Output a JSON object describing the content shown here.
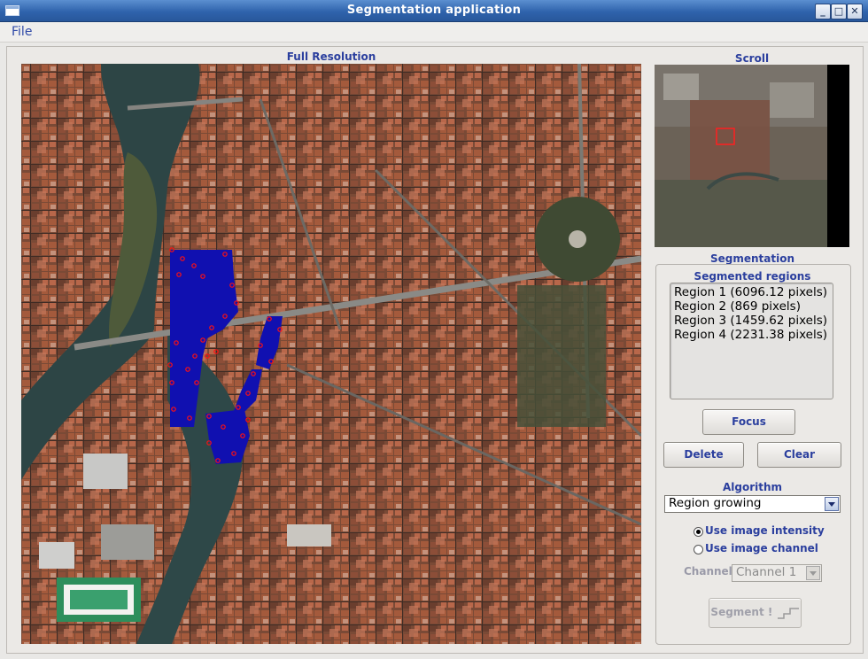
{
  "window": {
    "title": "Segmentation application"
  },
  "menu": {
    "file": "File"
  },
  "full_resolution": {
    "label": "Full Resolution"
  },
  "scroll": {
    "label": "Scroll"
  },
  "segmentation": {
    "label": "Segmentation",
    "regions_label": "Segmented regions",
    "regions": [
      "Region 1 (6096.12 pixels)",
      "Region 2 (869 pixels)",
      "Region 3 (1459.62 pixels)",
      "Region 4 (2231.38 pixels)"
    ],
    "focus_label": "Focus",
    "delete_label": "Delete",
    "clear_label": "Clear",
    "algorithm_label": "Algorithm",
    "algorithm_value": "Region growing",
    "radio_intensity": "Use image intensity",
    "radio_channel": "Use image channel",
    "selected_radio": "intensity",
    "channel_label": "Channel",
    "channel_value": "Channel 1",
    "segment_label": "Segment !"
  },
  "colors": {
    "accent_text": "#2b3f9e",
    "region_fill": "#1010b0",
    "seed_points": "#ff1010",
    "viewport_box": "#ff2020"
  }
}
